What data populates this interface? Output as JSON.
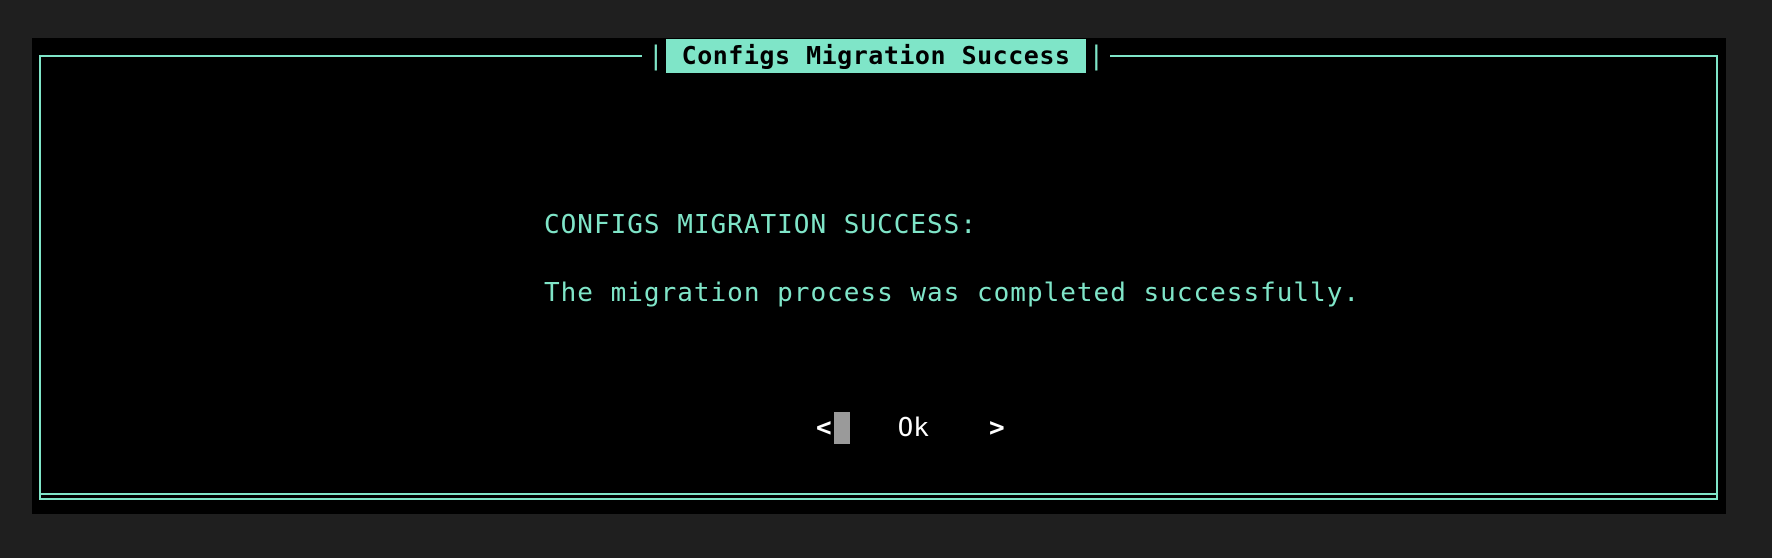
{
  "dialog": {
    "title": "Configs Migration Success",
    "title_pipe_left": "|",
    "title_pipe_right": "|",
    "heading": "CONFIGS MIGRATION SUCCESS:",
    "message": "The migration process was completed successfully.",
    "button": {
      "left_bracket": "<",
      "label": "Ok",
      "right_bracket": ">"
    }
  },
  "colors": {
    "accent": "#7fe5c8",
    "background": "#000000",
    "outer_background": "#1f1f1f",
    "button_text": "#ffffff",
    "cursor": "#9a9a9a"
  }
}
